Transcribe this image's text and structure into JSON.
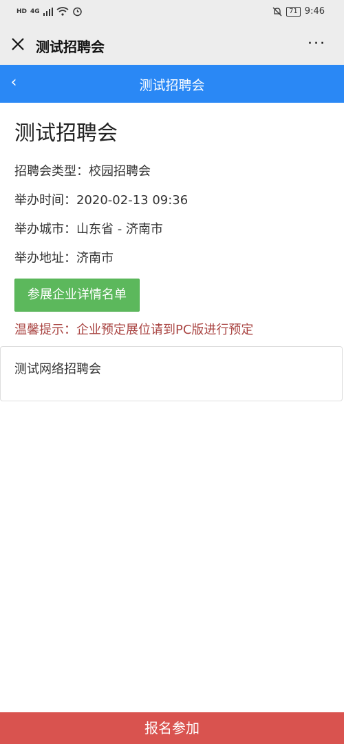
{
  "status_bar": {
    "hd_label": "HD",
    "network_label": "4G",
    "battery": "71",
    "time": "9:46"
  },
  "wechat_bar": {
    "title": "测试招聘会",
    "more": "···"
  },
  "header": {
    "back": "‹",
    "title": "测试招聘会"
  },
  "event": {
    "title": "测试招聘会",
    "type_row": "招聘会类型：校园招聘会",
    "time_row": "举办时间：2020-02-13 09:36",
    "city_row": "举办城市：山东省 - 济南市",
    "address_row": "举办地址：济南市",
    "detail_button": "参展企业详情名单",
    "tip": "温馨提示：企业预定展位请到PC版进行预定"
  },
  "card": {
    "text": "测试网络招聘会"
  },
  "footer": {
    "signup_button": "报名参加"
  }
}
